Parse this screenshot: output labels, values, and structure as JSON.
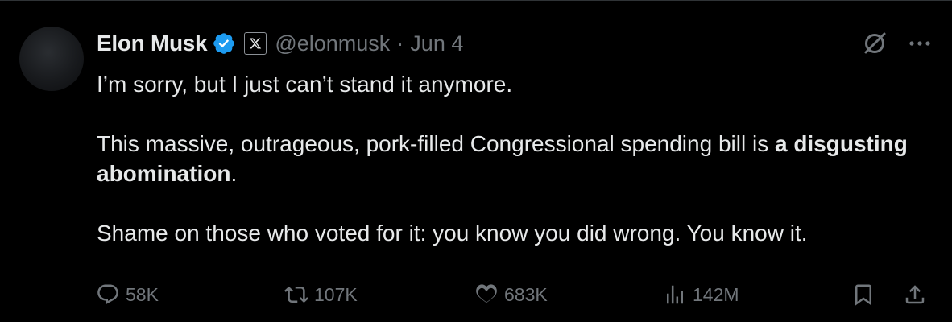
{
  "colors": {
    "background": "#000000",
    "primary_text": "#e7e9ea",
    "secondary_text": "#71767b",
    "verified_badge": "#1d9bf0",
    "divider": "#2f3336"
  },
  "author": {
    "display_name": "Elon Musk",
    "handle": "@elonmusk",
    "separator": "·",
    "date": "Jun 4",
    "badge_icon": "verified-badge-icon",
    "affiliation_icon": "x-logo-icon"
  },
  "tweet": {
    "line1": "I’m sorry, but I just can’t stand it anymore.",
    "para2_prefix": "This massive, outrageous, pork-filled Congressional spending bill is ",
    "para2_bold": "a disgusting abomination",
    "para2_suffix": ".",
    "line3": "Shame on those who voted for it: you know you did wrong. You know it."
  },
  "metrics": {
    "replies": "58K",
    "reposts": "107K",
    "likes": "683K",
    "views": "142M"
  },
  "icons": {
    "top_right": [
      "grok-icon",
      "more-icon"
    ],
    "action_bar": [
      "reply-icon",
      "repost-icon",
      "like-icon",
      "views-icon",
      "bookmark-icon",
      "share-icon"
    ]
  }
}
